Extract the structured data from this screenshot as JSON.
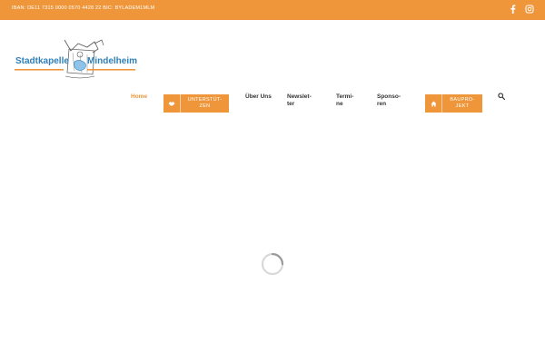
{
  "topbar": {
    "iban_text": "IBAN: DE11 7315 0000 0570 4428 22 BIC: BYLADEM1MLM",
    "social": [
      {
        "icon": "facebook-icon"
      },
      {
        "icon": "instagram-icon"
      }
    ]
  },
  "logo": {
    "left_word": "Stadtkapelle",
    "right_word": "Mindelheim"
  },
  "nav": {
    "home": "Home",
    "support_button": {
      "label": "UNTERSTÜT-\nZEN",
      "icon": "handshake-icon"
    },
    "about": "Über Uns",
    "newsletter": "Newslet-\nter",
    "dates": "Termi-\nne",
    "sponsors": "Sponso-\nren",
    "building_button": {
      "label": "BAUPRO-\nJEKT",
      "icon": "home-icon"
    },
    "search_icon": "search-icon"
  },
  "colors": {
    "accent": "#f0963a",
    "logo_blue": "#2f7fb8",
    "text": "#333333",
    "background": "#ffffff"
  }
}
